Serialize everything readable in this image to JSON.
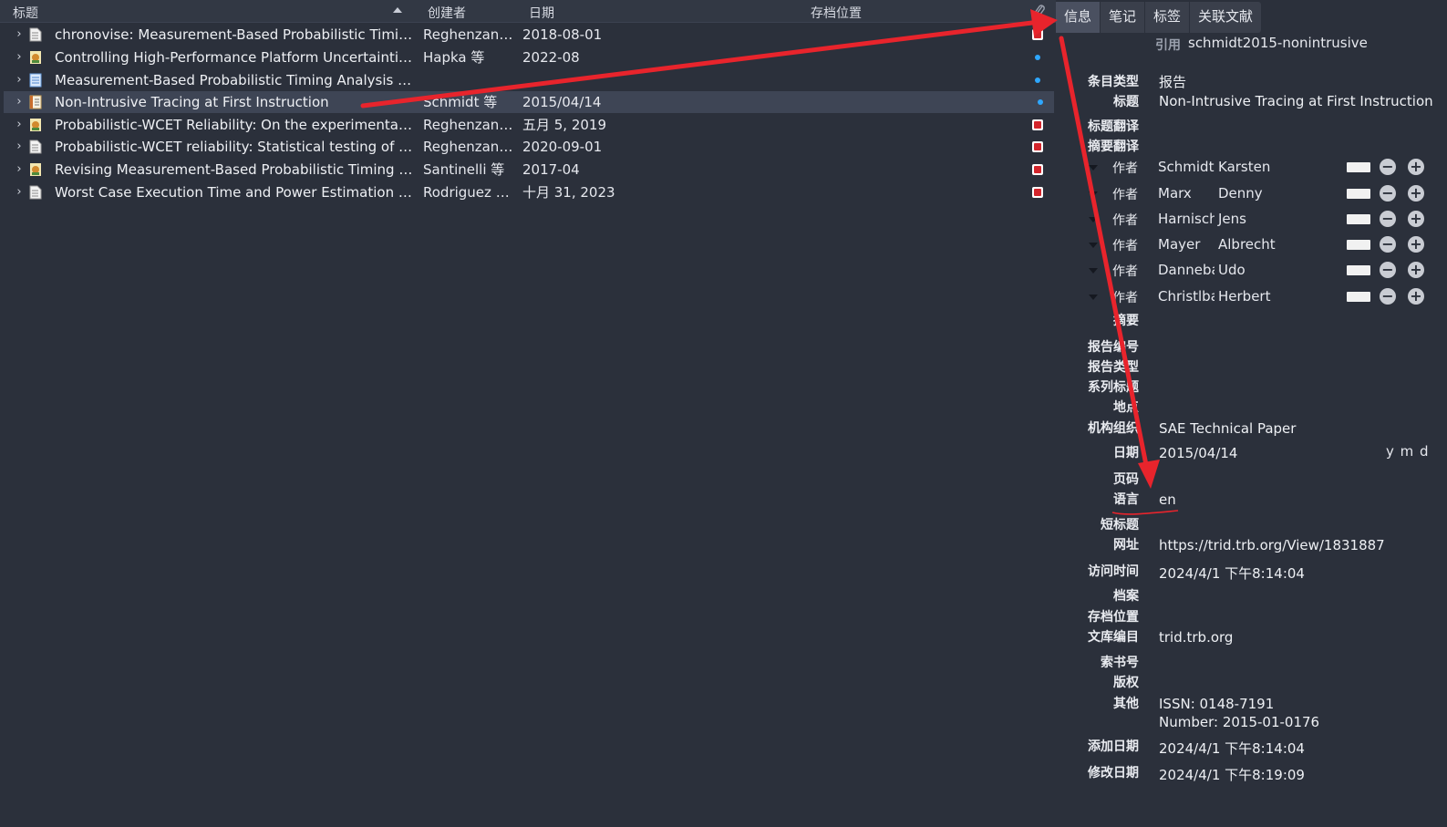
{
  "list_header": {
    "title": "标题",
    "creator": "创建者",
    "date": "日期",
    "archive_location": "存档位置"
  },
  "items": [
    {
      "title": "chronovise: Measurement-Based Probabilistic Timing...",
      "creator": "Reghenzani...",
      "date": "2018-08-01",
      "item_icon": "document-icon",
      "attachment": "pdf"
    },
    {
      "title": "Controlling High-Performance Platform Uncertainties...",
      "creator": "Hapka 等",
      "date": "2022-08",
      "item_icon": "thesis-icon",
      "attachment": "dot"
    },
    {
      "title": "Measurement-Based Probabilistic Timing Analysis for...",
      "creator": "",
      "date": "",
      "item_icon": "webpage-icon",
      "attachment": "dot"
    },
    {
      "title": "Non-Intrusive Tracing at First Instruction",
      "creator": "Schmidt 等",
      "date": "2015/04/14",
      "item_icon": "report-icon",
      "attachment": "dot",
      "selected": true
    },
    {
      "title": "Probabilistic-WCET Reliability: On the experimental v...",
      "creator": "Reghenzani...",
      "date": "五月 5, 2019",
      "item_icon": "thesis-icon",
      "attachment": "pdf"
    },
    {
      "title": "Probabilistic-WCET reliability: Statistical testing of EV...",
      "creator": "Reghenzani...",
      "date": "2020-09-01",
      "item_icon": "document-icon",
      "attachment": "pdf"
    },
    {
      "title": "Revising Measurement-Based Probabilistic Timing A...",
      "creator": "Santinelli 等",
      "date": "2017-04",
      "item_icon": "thesis-icon",
      "attachment": "pdf"
    },
    {
      "title": "Worst Case Execution Time and Power Estimation of ...",
      "creator": "Rodriguez F...",
      "date": "十月 31, 2023",
      "item_icon": "document-icon",
      "attachment": "pdf"
    }
  ],
  "tabs": [
    "信息",
    "笔记",
    "标签",
    "关联文献"
  ],
  "info": {
    "citekey_label": "引用",
    "citekey": "schmidt2015-nonintrusive",
    "item_type_label": "条目类型",
    "item_type": "报告",
    "title_label": "标题",
    "title": "Non-Intrusive Tracing at First Instruction",
    "title_translation_label": "标题翻译",
    "abstract_translation_label": "摘要翻译",
    "author_role": "作者",
    "authors": [
      {
        "last": "Schmidt",
        "first": "Karsten"
      },
      {
        "last": "Marx",
        "first": "Denny"
      },
      {
        "last": "Harnisch",
        "first": "Jens"
      },
      {
        "last": "Mayer",
        "first": "Albrecht"
      },
      {
        "last": "Dannebaum",
        "first": "Udo"
      },
      {
        "last": "Christlbauer",
        "first": "Herbert"
      }
    ],
    "abstract_label": "摘要",
    "report_number_label": "报告编号",
    "report_type_label": "报告类型",
    "series_title_label": "系列标题",
    "place_label": "地点",
    "institution_label": "机构组织",
    "institution": "SAE Technical Paper",
    "date_label": "日期",
    "date": "2015/04/14",
    "date_order": "y m d",
    "pages_label": "页码",
    "language_label": "语言",
    "language": "en",
    "short_title_label": "短标题",
    "url_label": "网址",
    "url": "https://trid.trb.org/View/1831887",
    "accessed_label": "访问时间",
    "accessed": "2024/4/1 下午8:14:04",
    "archive_label": "档案",
    "archive_location_label": "存档位置",
    "library_catalog_label": "文库编目",
    "library_catalog": "trid.trb.org",
    "call_number_label": "索书号",
    "rights_label": "版权",
    "extra_label": "其他",
    "extra_line1": "ISSN: 0148-7191",
    "extra_line2": "Number: 2015-01-0176",
    "date_added_label": "添加日期",
    "date_added": "2024/4/1 下午8:14:04",
    "date_modified_label": "修改日期",
    "date_modified": "2024/4/1 下午8:19:09"
  },
  "annotation_color": "#e8242c"
}
